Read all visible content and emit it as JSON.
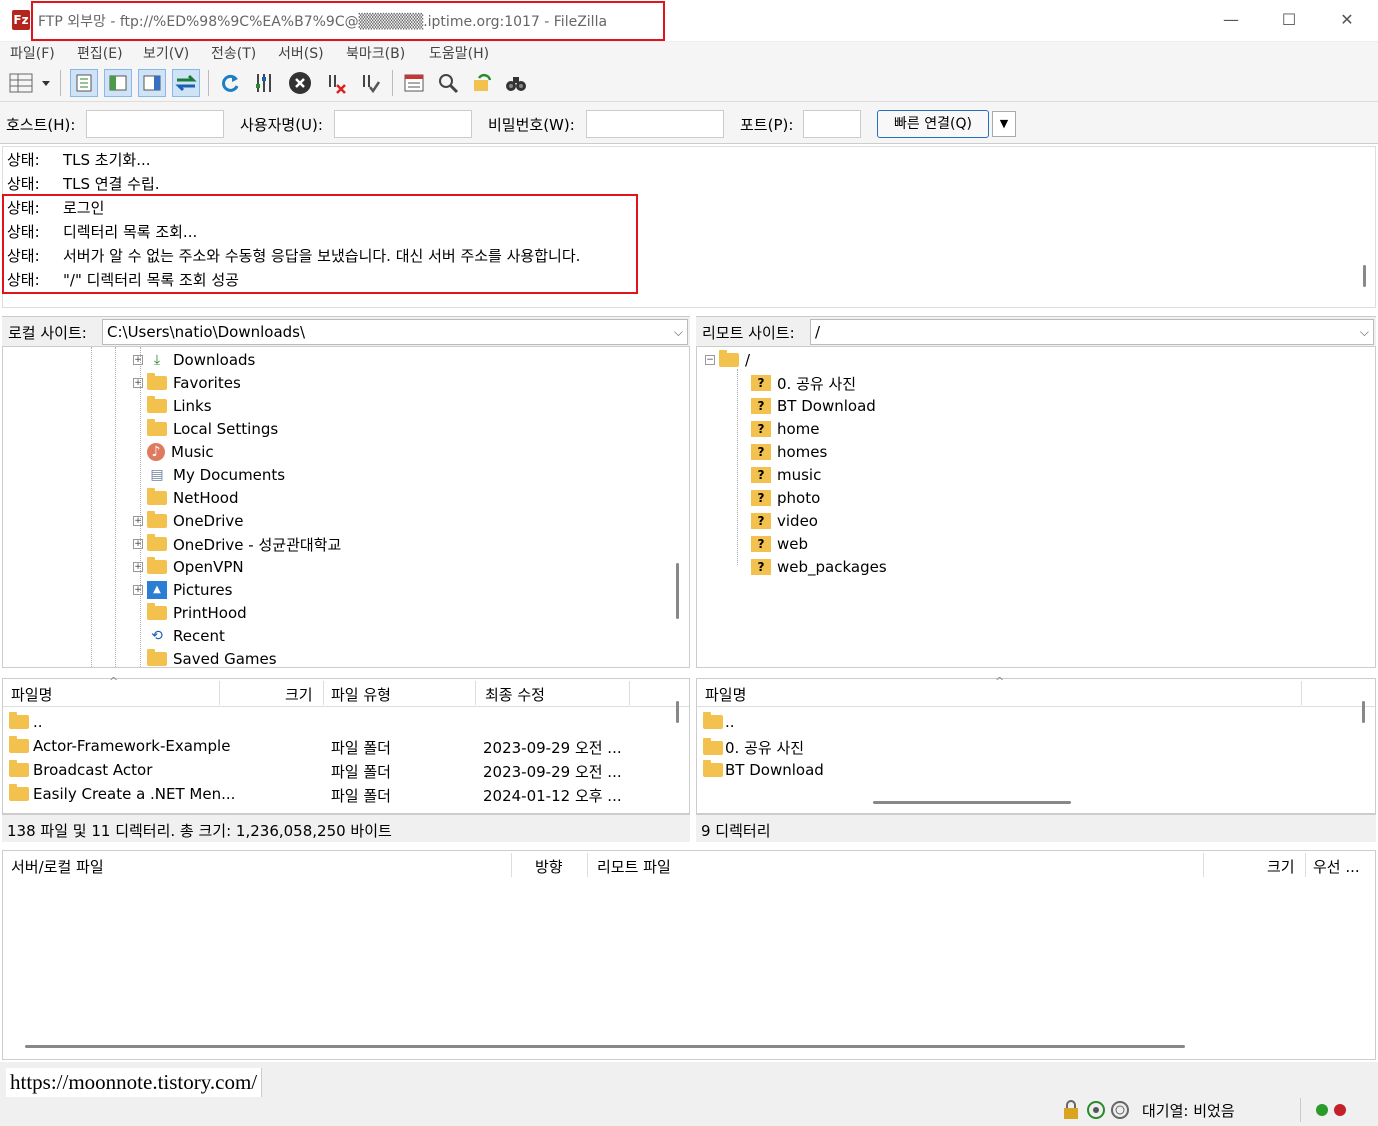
{
  "window": {
    "title": "FTP 외부망 - ftp://%ED%98%9C%EA%B7%9C@▒▒▒▒▒▒.iptime.org:1017 - FileZilla",
    "app_icon": "Fz",
    "minimize": "—",
    "maximize": "☐",
    "close": "✕"
  },
  "menu": [
    "파일(F)",
    "편집(E)",
    "보기(V)",
    "전송(T)",
    "서버(S)",
    "북마크(B)",
    "도움말(H)"
  ],
  "quickconnect": {
    "host_label": "호스트(H):",
    "user_label": "사용자명(U):",
    "pass_label": "비밀번호(W):",
    "port_label": "포트(P):",
    "host_value": "",
    "user_value": "",
    "pass_value": "",
    "port_value": "",
    "button": "빠른 연결(Q)",
    "dropdown": "▼"
  },
  "log": [
    {
      "label": "상태:",
      "text": "TLS 초기화..."
    },
    {
      "label": "상태:",
      "text": "TLS 연결 수립."
    },
    {
      "label": "상태:",
      "text": "로그인"
    },
    {
      "label": "상태:",
      "text": "디렉터리 목록 조회..."
    },
    {
      "label": "상태:",
      "text": "서버가 알 수 없는 주소와 수동형 응답을 보냈습니다. 대신 서버 주소를 사용합니다."
    },
    {
      "label": "상태:",
      "text": "\"/\" 디렉터리 목록 조회 성공"
    }
  ],
  "local": {
    "label": "로컬 사이트:",
    "path": "C:\\Users\\natio\\Downloads\\",
    "tree": [
      {
        "name": "Downloads",
        "icon": "download-arrow-icon",
        "expander": "+"
      },
      {
        "name": "Favorites",
        "icon": "folder-icon",
        "expander": "+"
      },
      {
        "name": "Links",
        "icon": "folder-icon",
        "expander": ""
      },
      {
        "name": "Local Settings",
        "icon": "folder-icon",
        "expander": ""
      },
      {
        "name": "Music",
        "icon": "music-icon",
        "expander": ""
      },
      {
        "name": "My Documents",
        "icon": "document-icon",
        "expander": ""
      },
      {
        "name": "NetHood",
        "icon": "folder-icon",
        "expander": ""
      },
      {
        "name": "OneDrive",
        "icon": "folder-icon",
        "expander": "+"
      },
      {
        "name": "OneDrive - 성균관대학교",
        "icon": "folder-icon",
        "expander": "+"
      },
      {
        "name": "OpenVPN",
        "icon": "folder-icon",
        "expander": "+"
      },
      {
        "name": "Pictures",
        "icon": "pictures-icon",
        "expander": "+"
      },
      {
        "name": "PrintHood",
        "icon": "folder-icon",
        "expander": ""
      },
      {
        "name": "Recent",
        "icon": "recent-icon",
        "expander": ""
      },
      {
        "name": "Saved Games",
        "icon": "folder-icon",
        "expander": ""
      }
    ],
    "columns": [
      "파일명",
      "크기",
      "파일 유형",
      "최종 수정"
    ],
    "files": [
      {
        "name": "..",
        "type": "",
        "modified": ""
      },
      {
        "name": "Actor-Framework-Example",
        "type": "파일 폴더",
        "modified": "2023-09-29 오전 ..."
      },
      {
        "name": "Broadcast Actor",
        "type": "파일 폴더",
        "modified": "2023-09-29 오전 ..."
      },
      {
        "name": "Easily Create a .NET Men...",
        "type": "파일 폴더",
        "modified": "2024-01-12 오후 ..."
      }
    ],
    "status": "138 파일 및 11 디렉터리. 총 크기: 1,236,058,250 바이트"
  },
  "remote": {
    "label": "리모트 사이트:",
    "path": "/",
    "root": "/",
    "tree": [
      "0. 공유 사진",
      "BT Download",
      "home",
      "homes",
      "music",
      "photo",
      "video",
      "web",
      "web_packages"
    ],
    "columns": [
      "파일명"
    ],
    "files": [
      "..",
      "0. 공유 사진",
      "BT Download"
    ],
    "status": "9 디렉터리"
  },
  "queue": {
    "columns": [
      "서버/로컬 파일",
      "방향",
      "리모트 파일",
      "크기",
      "우선 ..."
    ]
  },
  "watermark": "https://moonnote.tistory.com/",
  "statusbar": {
    "queue_text": "대기열: 비었음"
  },
  "colors": {
    "highlight_red": "#e0141a",
    "folder": "#f2c14e",
    "accent_blue": "#2a6fbf"
  }
}
